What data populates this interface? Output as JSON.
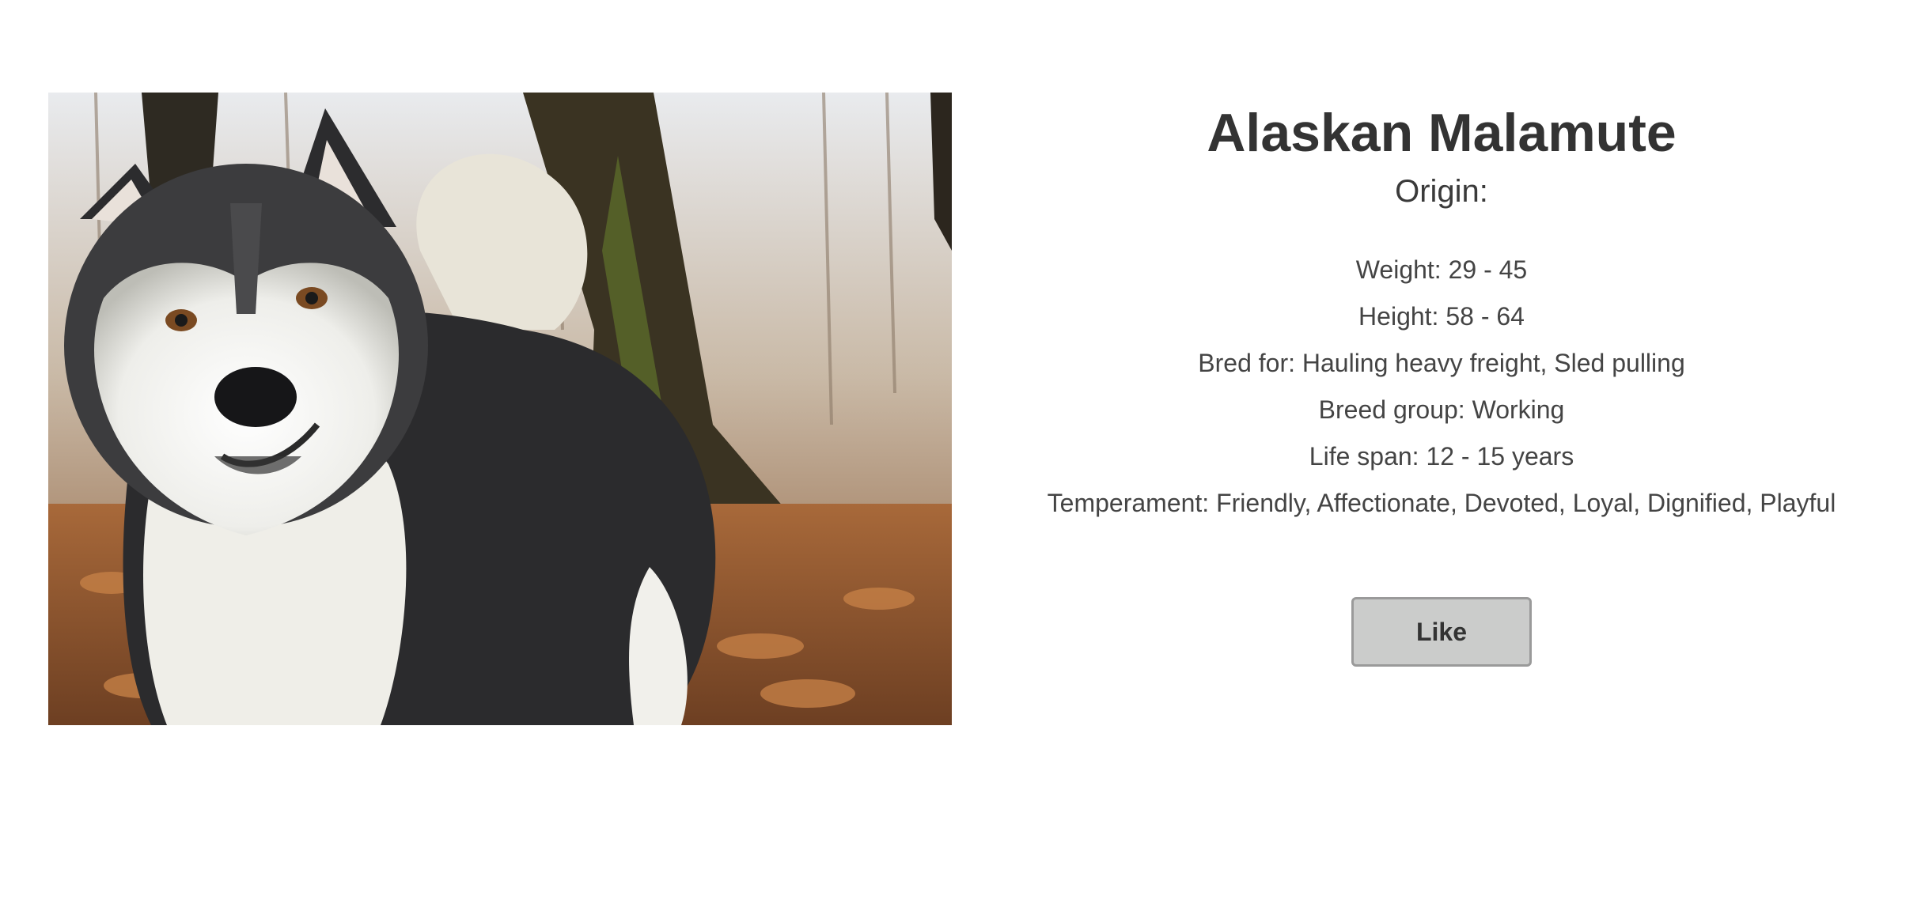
{
  "breed": {
    "name": "Alaskan Malamute",
    "origin_label": "Origin:",
    "facts": [
      "Weight: 29 - 45",
      "Height: 58 - 64",
      "Bred for: Hauling heavy freight, Sled pulling",
      "Breed group: Working",
      "Life span: 12 - 15 years",
      "Temperament: Friendly, Affectionate, Devoted, Loyal, Dignified, Playful"
    ]
  },
  "actions": {
    "like_label": "Like"
  },
  "image": {
    "icon": "dog-photo"
  },
  "colors": {
    "text": "#333333",
    "button_bg": "#cbcccb",
    "button_border": "#9a9a9a"
  }
}
